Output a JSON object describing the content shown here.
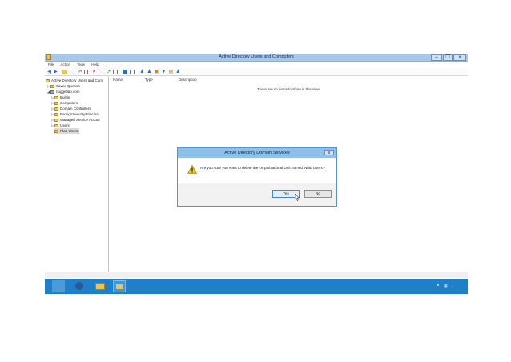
{
  "window": {
    "title": "Active Directory Users and Computers",
    "buttons": {
      "minimize": "–",
      "maximize": "❐",
      "close": "x"
    }
  },
  "menu": [
    "File",
    "Action",
    "View",
    "Help"
  ],
  "tree": {
    "root": "Active Directory Users and Com",
    "saved_queries": "Saved Queries",
    "domain": "nuggetlab.com",
    "children": [
      "Builtin",
      "Computers",
      "Domain Controllers",
      "ForeignSecurityPrincipal",
      "Managed Service Accour",
      "Users",
      "Nlab Users"
    ]
  },
  "content": {
    "columns": [
      "Name",
      "Type",
      "Description"
    ],
    "empty_message": "There are no items to show in this view."
  },
  "dialog": {
    "title": "Active Directory Domain Services",
    "close": "x",
    "message": "Are you sure you want to delete the Organizational Unit named 'Nlab Users'?",
    "yes": "Yes",
    "no": "No"
  },
  "scroll": {
    "position_label": "III"
  },
  "colors": {
    "titlebar": "#a9c7e8",
    "taskbar": "#1f80c9",
    "dialog_title": "#8ec0ea",
    "folder": "#e9c45b"
  }
}
